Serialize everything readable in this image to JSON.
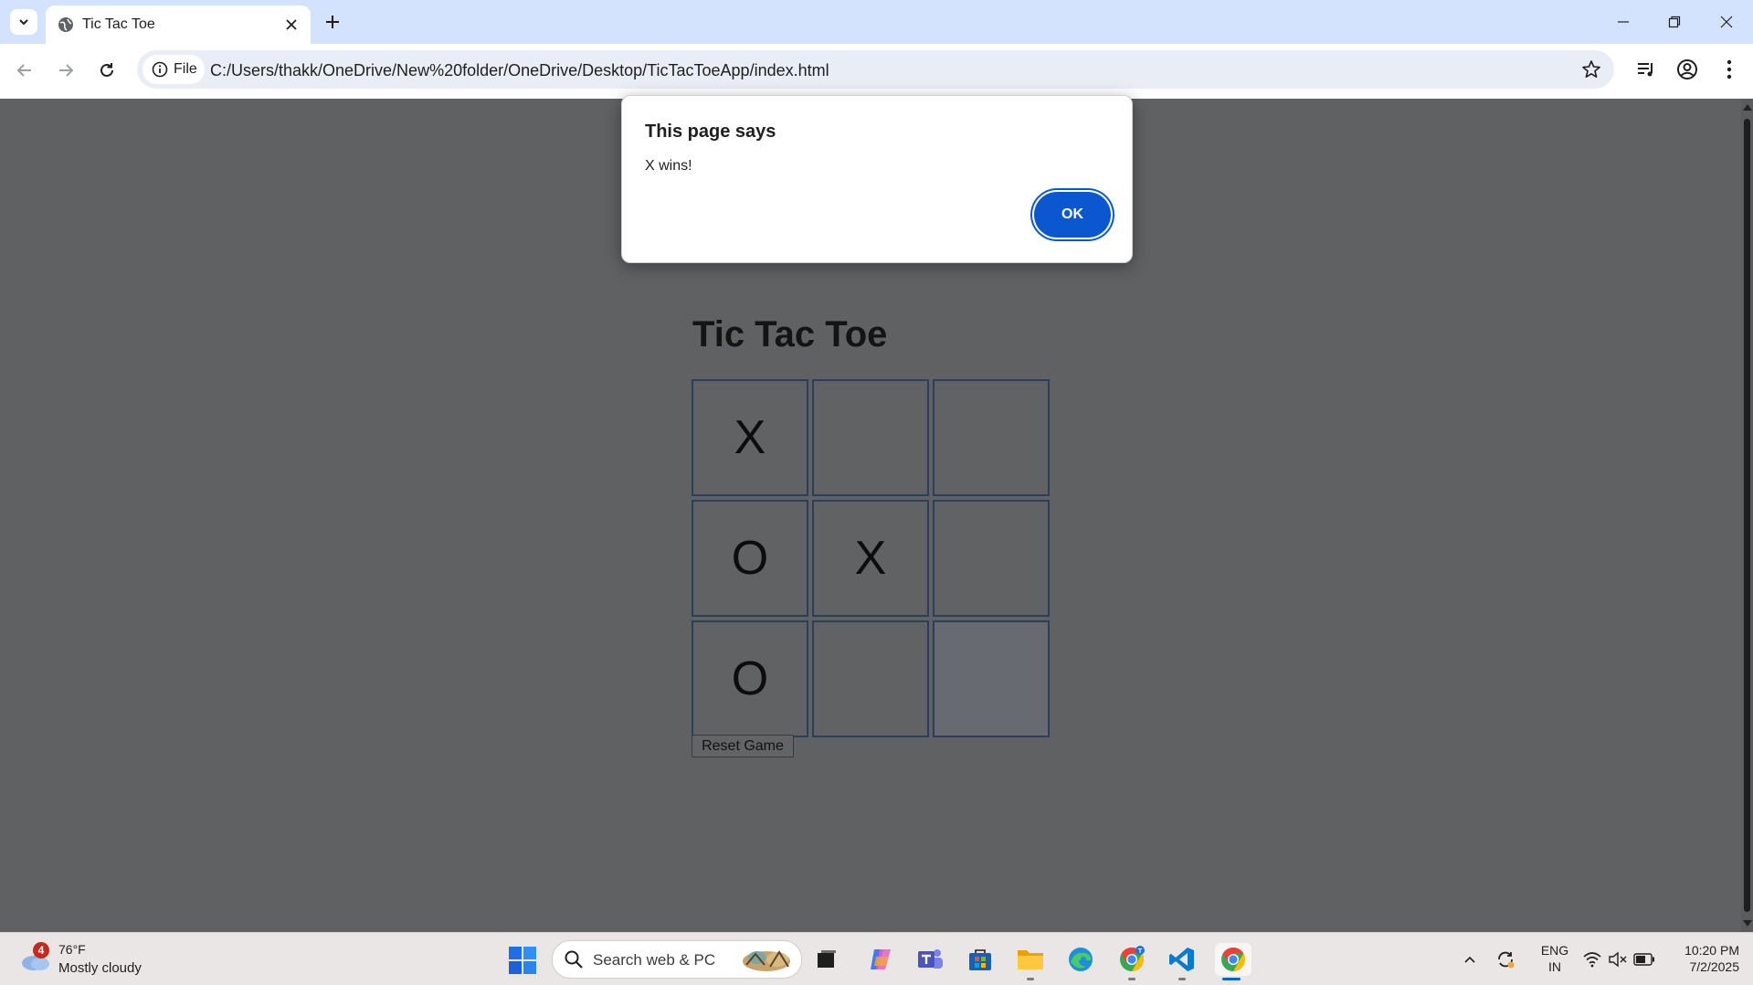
{
  "browser": {
    "tab_title": "Tic Tac Toe",
    "site_chip_label": "File",
    "url": "C:/Users/thakk/OneDrive/New%20folder/OneDrive/Desktop/TicTacToeApp/index.html"
  },
  "page": {
    "heading": "Tic Tac Toe",
    "board": [
      "X",
      "",
      "",
      "O",
      "X",
      "",
      "O",
      "",
      ""
    ],
    "reset_label": "Reset Game"
  },
  "dialog": {
    "title": "This page says",
    "message": "X wins!",
    "ok_label": "OK"
  },
  "taskbar": {
    "weather_badge": "4",
    "weather_temp": "76°F",
    "weather_condition": "Mostly cloudy",
    "search_placeholder": "Search web & PC",
    "lang_line1": "ENG",
    "lang_line2": "IN",
    "time": "10:20 PM",
    "date": "7/2/2025"
  },
  "colors": {
    "dialog_button": "#0b57d0",
    "tabstrip": "#d3e3fd",
    "page_dimmed_bg": "#606163"
  },
  "icons": [
    "tab-search-icon",
    "globe-icon",
    "close-icon",
    "plus-icon",
    "back-icon",
    "forward-icon",
    "reload-icon",
    "info-icon",
    "star-icon",
    "media-icon",
    "profile-icon",
    "menu-icon",
    "windows-icon",
    "search-icon",
    "wifi-icon",
    "mute-icon",
    "battery-icon"
  ]
}
